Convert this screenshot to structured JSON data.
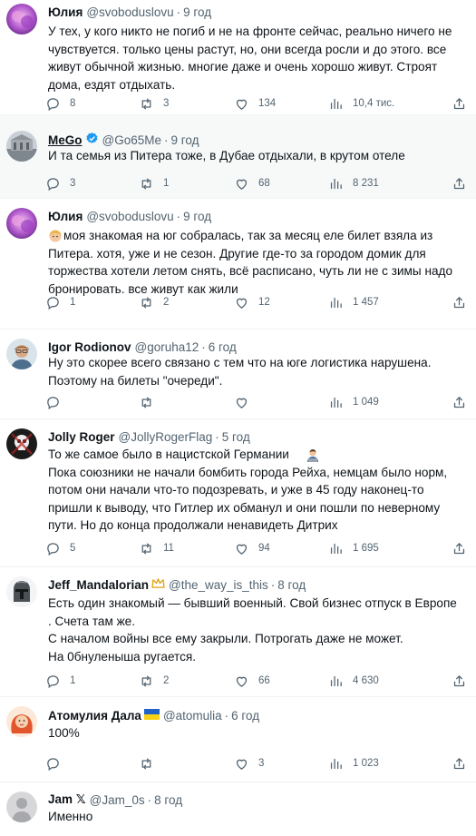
{
  "tweets": [
    {
      "name": "Юлия",
      "handle": "@svobodusl​ovu",
      "time": "9 год",
      "text": "У тех, у кого никто не погиб и не на фронте сейчас, реально ничего не\nчувствуется. только цены растут, но, они всегда росли и до этого. все\nживут обычной жизнью. многие даже и очень хорошо живут. Строят\nдома, ездят отдыхать.",
      "replies": "8",
      "retweets": "3",
      "likes": "134",
      "views": "10,4 тис."
    },
    {
      "name": "MeGo",
      "handle": "@Go65Me",
      "time": "9 год",
      "text": "И та семья из Питера тоже, в Дубае отдыхали, в крутом отеле",
      "replies": "3",
      "retweets": "1",
      "likes": "68",
      "views": "8 231"
    },
    {
      "name": "Юлия",
      "handle": "@svobodusl​ovu",
      "time": "9 год",
      "text": "моя знакомая на юг собралась, так за месяц еле билет взяла из\nПитера. хотя, уже и не сезон. Другие где-то за городом домик для\nторжества хотели летом снять, всё расписано, чуть ли не с зимы надо\nбронировать. все живут как жили",
      "replies": "1",
      "retweets": "2",
      "likes": "12",
      "views": "1 457"
    },
    {
      "name": "Igor Rodionov",
      "handle": "@goruha12",
      "time": "6 год",
      "text": "Ну это скорее всего связано с тем что на юге логистика нарушена.\nПоэтому на билеты \"очереди\".",
      "replies": "",
      "retweets": "",
      "likes": "",
      "views": "1 049"
    },
    {
      "name": "Jolly Roger",
      "handle": "@JollyRogerFlag",
      "time": "5 год",
      "text": "То же самое было в нацистской Германии\nПока союзники не начали бомбить города Рейха, немцам было норм,\nпотом они начали что-то подозревать, и уже в 45 году наконец-то\nпришли к выводу, что Гитлер их обманул и они пошли по неверному\nпути. Но до конца продолжали ненавидеть Дитрих",
      "replies": "5",
      "retweets": "11",
      "likes": "94",
      "views": "1 695"
    },
    {
      "name": "Jeff_Mandalorian",
      "handle": "@the_way_is_this",
      "time": "8 год",
      "text": "Есть один знакомый — бывший военный. Свой бизнес отпуск в Европе\n. Счета там же.\nС началом войны все ему закрыли. Потрогать даже не может.\nНа 0бнуленыша ругается.",
      "replies": "1",
      "retweets": "2",
      "likes": "66",
      "views": "4 630"
    },
    {
      "name": "Атомулия Дала",
      "handle": "@atomulia",
      "time": "6 год",
      "text": "100%",
      "replies": "",
      "retweets": "",
      "likes": "3",
      "views": "1 023"
    },
    {
      "name": "Jam 𝕏",
      "handle": "@Jam_0s",
      "time": "8 год",
      "text": "Именно",
      "replies": "",
      "retweets": "",
      "likes": "",
      "views": ""
    }
  ],
  "colors": {
    "text": "#0f1419",
    "secondary": "#536471",
    "divider": "#eff3f4",
    "verified": "#1d9bf0",
    "highlight_bg": "#f7f9f9"
  },
  "icons": [
    "reply-icon",
    "retweet-icon",
    "like-icon",
    "views-icon",
    "share-icon",
    "verified-badge-icon",
    "ukraine-flag-icon",
    "crown-emoji-icon",
    "girl-emoji-icon",
    "man-at-laptop-emoji-icon"
  ]
}
